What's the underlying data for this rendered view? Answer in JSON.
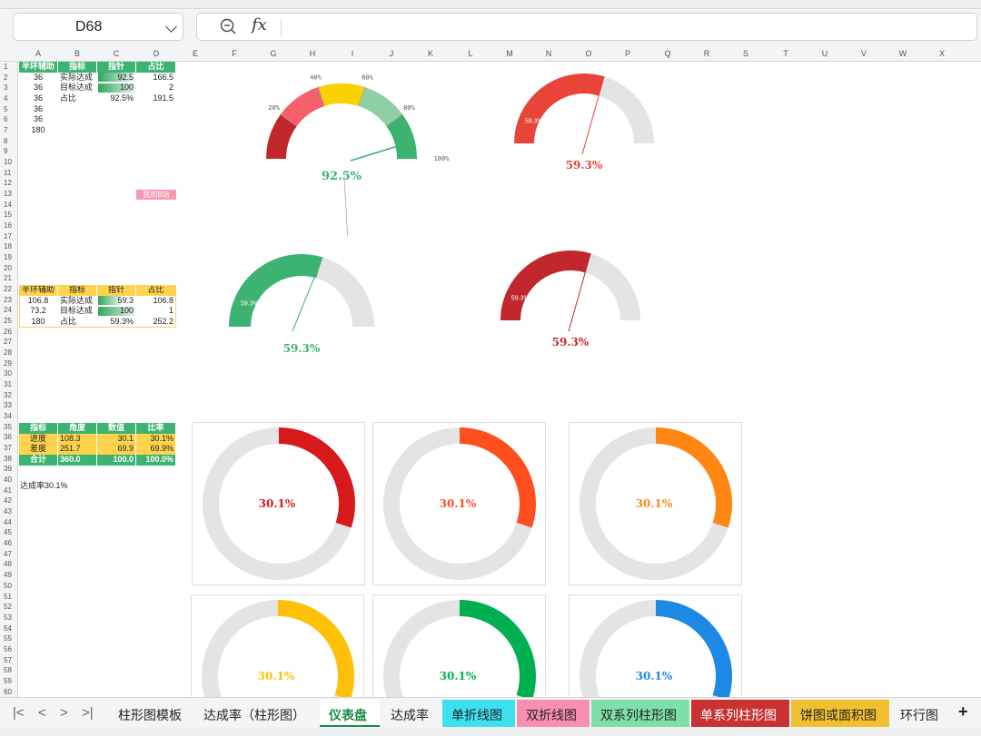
{
  "namebox": "D68",
  "formula": {
    "fx_label": "fx"
  },
  "columns": [
    "A",
    "B",
    "C",
    "D",
    "E",
    "F",
    "G",
    "H",
    "I",
    "J",
    "K",
    "L",
    "M",
    "N",
    "O",
    "P",
    "Q",
    "R",
    "S",
    "T",
    "U",
    "V",
    "W",
    "X"
  ],
  "rows": [
    "1",
    "2",
    "3",
    "4",
    "5",
    "6",
    "7",
    "8",
    "9",
    "10",
    "11",
    "12",
    "13",
    "14",
    "15",
    "16",
    "17",
    "18",
    "19",
    "20",
    "21",
    "22",
    "23",
    "24",
    "25",
    "26",
    "27",
    "28",
    "29",
    "30",
    "31",
    "32",
    "33",
    "34",
    "35",
    "36",
    "37",
    "38",
    "39",
    "40",
    "41",
    "42",
    "43",
    "44",
    "45",
    "46",
    "47",
    "48",
    "49",
    "50",
    "51",
    "52",
    "53",
    "54",
    "55",
    "56",
    "57",
    "58",
    "59",
    "60"
  ],
  "table1": {
    "headers": [
      "半环辅助",
      "指标",
      "指针",
      "占比"
    ],
    "rows": [
      [
        "36",
        "实际达成",
        "92.5",
        "166.5"
      ],
      [
        "36",
        "目标达成",
        "100",
        "2"
      ],
      [
        "36",
        "占比",
        "92.5%",
        "191.5"
      ],
      [
        "36",
        "",
        "",
        ""
      ],
      [
        "36",
        "",
        "",
        ""
      ],
      [
        "180",
        "",
        "",
        ""
      ]
    ]
  },
  "pink_label": "我的B站",
  "table2": {
    "headers": [
      "半环辅助",
      "指标",
      "指针",
      "占比"
    ],
    "rows": [
      [
        "106.8",
        "实际达成",
        "59.3",
        "106.8"
      ],
      [
        "73.2",
        "目标达成",
        "100",
        "1"
      ],
      [
        "180",
        "占比",
        "59.3%",
        "252.2"
      ]
    ]
  },
  "table3": {
    "headers": [
      "指标",
      "角度",
      "数值",
      "比率"
    ],
    "rows": [
      [
        "进度",
        "108.3",
        "30.1",
        "30.1%"
      ],
      [
        "差度",
        "251.7",
        "69.9",
        "69.9%"
      ],
      [
        "合计",
        "360.0",
        "100.0",
        "100.0%"
      ]
    ]
  },
  "note": "达成率30.1%",
  "gauge_main": {
    "value_label": "92.5%",
    "ticks": [
      "20%",
      "40%",
      "60%",
      "80%",
      "100%"
    ],
    "value": 92.5,
    "colors": [
      "#c0282d",
      "#f4606c",
      "#f7d200",
      "#8fcfa3",
      "#3cb371"
    ]
  },
  "gauges": [
    {
      "value": 59.3,
      "label": "59.3%",
      "small_label": "59.3%",
      "color": "#e84438"
    },
    {
      "value": 59.3,
      "label": "59.3%",
      "small_label": "59.3%",
      "color": "#3cb371"
    },
    {
      "value": 59.3,
      "label": "59.3%",
      "small_label": "59.3%",
      "color": "#c0282d"
    }
  ],
  "donuts": [
    {
      "value": 30.1,
      "label": "30.1%",
      "color": "#d7191c"
    },
    {
      "value": 30.1,
      "label": "30.1%",
      "color": "#ff4f1f"
    },
    {
      "value": 30.1,
      "label": "30.1%",
      "color": "#ff8612"
    },
    {
      "value": 30.1,
      "label": "30.1%",
      "color": "#ffc107"
    },
    {
      "value": 30.1,
      "label": "30.1%",
      "color": "#00b050"
    },
    {
      "value": 30.1,
      "label": "30.1%",
      "color": "#1e88e5"
    }
  ],
  "tabs": [
    {
      "label": "柱形图模板",
      "bg": "#f3f4f6"
    },
    {
      "label": "达成率（柱形图）",
      "bg": "#f3f4f6"
    },
    {
      "label": "仪表盘",
      "bg": "#ffffff",
      "active": true
    },
    {
      "label": "达成率",
      "bg": "#f3f4f6"
    },
    {
      "label": "单折线图",
      "bg": "#3ee0f0"
    },
    {
      "label": "双折线图",
      "bg": "#f78fb0"
    },
    {
      "label": "双系列柱形图",
      "bg": "#7ee0a8"
    },
    {
      "label": "单系列柱形图",
      "bg": "#c93232"
    },
    {
      "label": "饼图或面积图",
      "bg": "#f0c030"
    },
    {
      "label": "环行图",
      "bg": "#f3f4f6"
    }
  ],
  "add_sheet": "+"
}
